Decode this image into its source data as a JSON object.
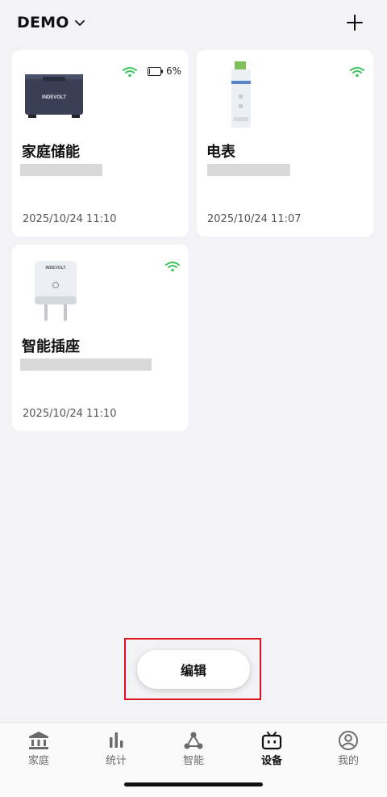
{
  "header": {
    "home_name": "DEMO"
  },
  "devices": [
    {
      "name": "家庭储能",
      "timestamp": "2025/10/24 11:10",
      "battery": "6%",
      "image_brand": "INDEVOLT"
    },
    {
      "name": "电表",
      "timestamp": "2025/10/24 11:07"
    },
    {
      "name": "智能插座",
      "timestamp": "2025/10/24 11:10",
      "image_brand": "INDEVOLT"
    }
  ],
  "edit_label": "编辑",
  "tabs": [
    {
      "label": "家庭",
      "icon": "home-icon"
    },
    {
      "label": "统计",
      "icon": "stats-icon"
    },
    {
      "label": "智能",
      "icon": "smart-icon"
    },
    {
      "label": "设备",
      "icon": "device-icon",
      "active": true
    },
    {
      "label": "我的",
      "icon": "profile-icon"
    }
  ],
  "colors": {
    "wifi": "#3cc35a",
    "accent_red": "#e0141c",
    "text": "#111111"
  }
}
